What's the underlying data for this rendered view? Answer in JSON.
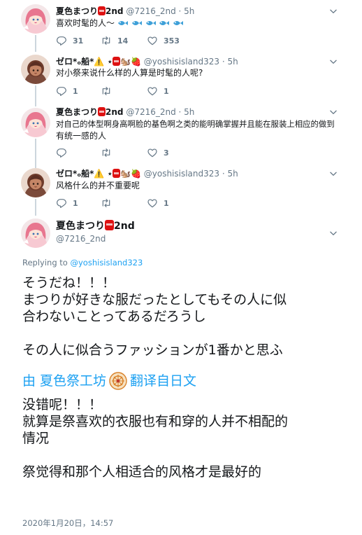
{
  "tweets": [
    {
      "name": "夏色まつり",
      "suffix": "2nd",
      "handle": "@7216_2nd · 5h",
      "text": "喜欢时髦的人～",
      "replies": "31",
      "retweets": "14",
      "likes": "353"
    },
    {
      "name": "ゼロ*ₒ船*⚠️ ⋆",
      "handle": "@yoshisisland323 · 5h",
      "text": "对小祭来说什么样的人算是时髦的人呢?",
      "replies": "1",
      "retweets": "",
      "likes": "1"
    },
    {
      "name": "夏色まつり",
      "suffix": "2nd",
      "handle": "@7216_2nd · 5h",
      "text_line1": "对自己的体型啊身高啊脸的基色啊之类的能明确掌握并且能在服装上相应的做到",
      "text_line2": "有统一感的人",
      "replies": "",
      "retweets": "",
      "likes": "3"
    },
    {
      "name": "ゼロ*ₒ船*⚠️ ⋆",
      "handle": "@yoshisisland323 · 5h",
      "text": "风格什么的并不重要呢",
      "replies": "1",
      "retweets": "",
      "likes": "1"
    }
  ],
  "main": {
    "name": "夏色まつり",
    "suffix": "2nd",
    "handle": "@7216_2nd",
    "replying_prefix": "Replying to",
    "replying_handle": "@yoshisisland323",
    "jp_line1": "そうだね！！！",
    "jp_line2": "まつりが好きな服だったとしてもその人に似",
    "jp_line3": "合わないことってあるだろうし",
    "jp_line4": "その人に似合うファッションが1番かと思ふ",
    "translation_prefix": "由 夏色祭工坊",
    "translation_suffix": "翻译自日文",
    "cn_line1": "没错呢！！！",
    "cn_line2": "就算是祭喜欢的衣服也有和穿的人并不相配的",
    "cn_line3": "情况",
    "cn_line4": "祭觉得和那个人相适合的风格才是最好的",
    "timestamp": "2020年1月20日，14:57"
  },
  "colors": {
    "accent": "#1da1f2",
    "secondary_text": "#657786",
    "thread_line": "#ccd6dd"
  }
}
